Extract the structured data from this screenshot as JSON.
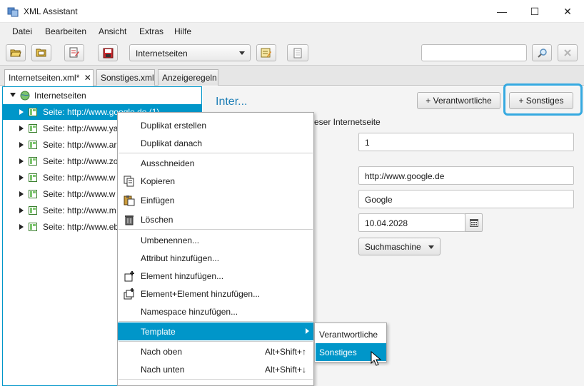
{
  "window": {
    "title": "XML Assistant",
    "minimize": "—",
    "maximize": "☐",
    "close": "✕"
  },
  "menubar": [
    "Datei",
    "Bearbeiten",
    "Ansicht",
    "Extras",
    "Hilfe"
  ],
  "toolbar": {
    "combo_value": "Internetseiten",
    "search_value": ""
  },
  "tabs": [
    {
      "label": "Internetseiten.xml*",
      "close": "✕"
    },
    {
      "label": "Sonstiges.xml"
    },
    {
      "label": "Anzeigeregeln"
    }
  ],
  "tree": {
    "root": "Internetseiten",
    "items": [
      "Seite: http://www.google.de (1)",
      "Seite: http://www.ya",
      "Seite: http://www.ar",
      "Seite: http://www.zo",
      "Seite: http://www.w",
      "Seite: http://www.w",
      "Seite: http://www.m",
      "Seite: http://www.eb"
    ]
  },
  "detail": {
    "title": "Inter...",
    "btn_verantwortliche": "+ Verantwortliche",
    "btn_sonstiges": "+ Sonstiges",
    "section_label": "eser Internetseite",
    "field_number": "1",
    "field_url": "http://www.google.de",
    "field_name": "Google",
    "field_date": "10.04.2028",
    "select_category": "Suchmaschine"
  },
  "context_menu": {
    "duplikat_erstellen": "Duplikat erstellen",
    "duplikat_danach": "Duplikat danach",
    "ausschneiden": "Ausschneiden",
    "kopieren": "Kopieren",
    "einfuegen": "Einfügen",
    "loeschen": "Löschen",
    "umbenennen": "Umbenennen...",
    "attribut": "Attribut hinzufügen...",
    "element": "Element hinzufügen...",
    "element_element": "Element+Element hinzufügen...",
    "namespace": "Namespace hinzufügen...",
    "template": "Template",
    "nach_oben": "Nach oben",
    "nach_oben_shortcut": "Alt+Shift+↑",
    "nach_unten": "Nach unten",
    "nach_unten_shortcut": "Alt+Shift+↓"
  },
  "submenu": {
    "verantwortliche": "Verantwortliche",
    "sonstiges": "Sonstiges"
  },
  "colors": {
    "accent": "#0096c9",
    "title_blue": "#1f7fb6",
    "highlight_ring": "#35a9e0"
  }
}
